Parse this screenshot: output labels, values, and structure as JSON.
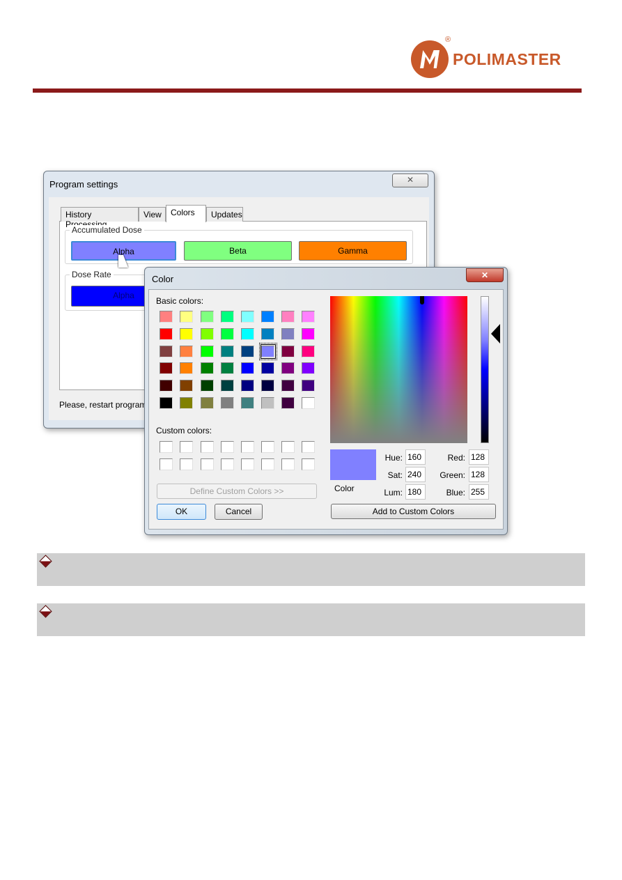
{
  "header": {
    "brand": "POLIMASTER",
    "registered": "®",
    "brand_color": "#c8592a",
    "rule_color": "#8b1a1a"
  },
  "settings": {
    "title": "Program settings",
    "close_icon": "close-icon",
    "tabs": [
      {
        "label": "History Processing"
      },
      {
        "label": "View"
      },
      {
        "label": "Colors",
        "selected": true
      },
      {
        "label": "Updates"
      }
    ],
    "accumulated": {
      "label": "Accumulated Dose",
      "buttons": [
        {
          "label": "Alpha",
          "color": "#8080ff"
        },
        {
          "label": "Beta",
          "color": "#80ff80"
        },
        {
          "label": "Gamma",
          "color": "#ff8000"
        }
      ]
    },
    "rate": {
      "label": "Dose Rate",
      "buttons": [
        {
          "label": "Alpha",
          "color": "#0000ff"
        }
      ]
    },
    "status": "Please, restart program"
  },
  "color_dialog": {
    "title": "Color",
    "basic_label": "Basic colors:",
    "basic_colors": [
      [
        "#FF8080",
        "#FFFF80",
        "#80FF80",
        "#00FF80",
        "#80FFFF",
        "#0080FF",
        "#FF80C0",
        "#FF80FF"
      ],
      [
        "#FF0000",
        "#FFFF00",
        "#80FF00",
        "#00FF40",
        "#00FFFF",
        "#0080C0",
        "#8080C0",
        "#FF00FF"
      ],
      [
        "#804040",
        "#FF8040",
        "#00FF00",
        "#008080",
        "#004080",
        "#8080FF",
        "#800040",
        "#FF0080"
      ],
      [
        "#800000",
        "#FF8000",
        "#008000",
        "#008040",
        "#0000FF",
        "#0000A0",
        "#800080",
        "#8000FF"
      ],
      [
        "#400000",
        "#804000",
        "#004000",
        "#004040",
        "#000080",
        "#000040",
        "#400040",
        "#400080"
      ],
      [
        "#000000",
        "#808000",
        "#808040",
        "#808080",
        "#408080",
        "#C0C0C0",
        "#400040",
        "#FFFFFF"
      ]
    ],
    "selected_basic": "#8080FF",
    "custom_label": "Custom colors:",
    "define_label": "Define Custom Colors >>",
    "ok_label": "OK",
    "cancel_label": "Cancel",
    "preview_label": "Color",
    "preview_color": "#8080FF",
    "hue_label": "Hue:",
    "hue": "160",
    "sat_label": "Sat:",
    "sat": "240",
    "lum_label": "Lum:",
    "lum": "180",
    "red_label": "Red:",
    "red": "128",
    "green_label": "Green:",
    "green": "128",
    "blue_label": "Blue:",
    "blue": "255",
    "add_label": "Add to Custom Colors"
  }
}
